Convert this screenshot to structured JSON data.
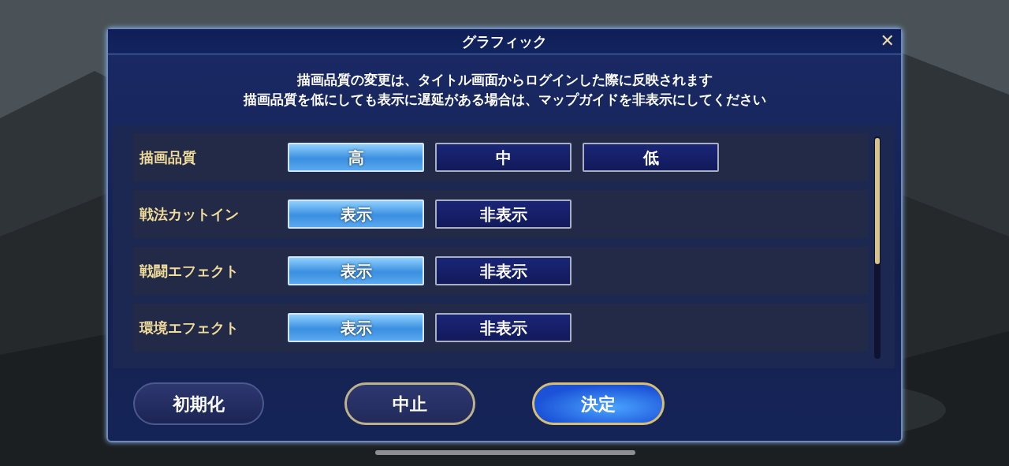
{
  "window": {
    "title": "グラフィック",
    "close": "✕"
  },
  "message": [
    "描画品質の変更は、タイトル画面からログインした際に反映されます",
    "描画品質を低にしても表示に遅延がある場合は、マップガイドを非表示にしてください"
  ],
  "settings": [
    {
      "label": "描画品質",
      "options": [
        {
          "label": "高",
          "selected": true
        },
        {
          "label": "中",
          "selected": false
        },
        {
          "label": "低",
          "selected": false
        }
      ]
    },
    {
      "label": "戦法カットイン",
      "options": [
        {
          "label": "表示",
          "selected": true
        },
        {
          "label": "非表示",
          "selected": false
        }
      ]
    },
    {
      "label": "戦闘エフェクト",
      "options": [
        {
          "label": "表示",
          "selected": true
        },
        {
          "label": "非表示",
          "selected": false
        }
      ]
    },
    {
      "label": "環境エフェクト",
      "options": [
        {
          "label": "表示",
          "selected": true
        },
        {
          "label": "非表示",
          "selected": false
        }
      ]
    }
  ],
  "buttons": [
    {
      "label": "初期化",
      "kind": "plain"
    },
    {
      "label": "中止",
      "kind": "framed"
    },
    {
      "label": "決定",
      "kind": "primary"
    }
  ]
}
